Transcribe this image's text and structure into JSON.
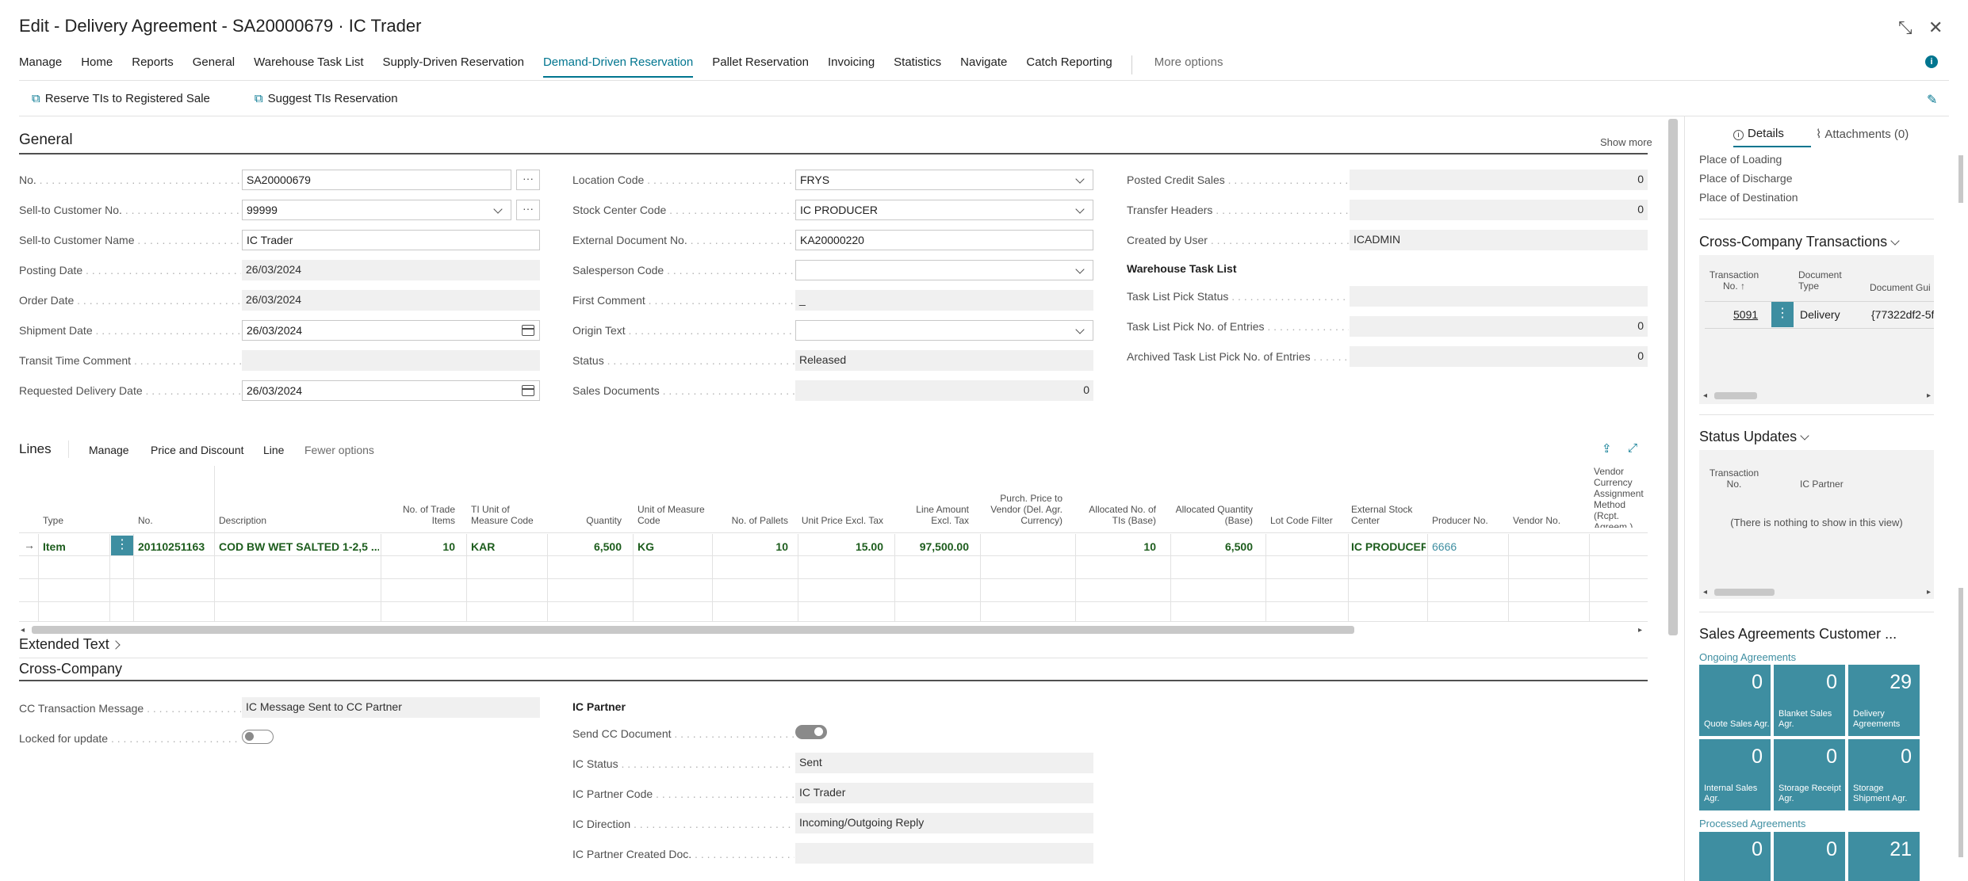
{
  "window": {
    "title": "Edit - Delivery Agreement - SA20000679 · IC Trader"
  },
  "menu": {
    "items": [
      "Manage",
      "Home",
      "Reports",
      "General",
      "Warehouse Task List",
      "Supply-Driven Reservation",
      "Demand-Driven Reservation",
      "Pallet Reservation",
      "Invoicing",
      "Statistics",
      "Navigate",
      "Catch Reporting"
    ],
    "more": "More options"
  },
  "actions": {
    "reserve": "Reserve TIs to Registered Sale",
    "suggest": "Suggest TIs Reservation"
  },
  "general": {
    "title": "General",
    "show_more": "Show more",
    "col1": [
      {
        "label": "No.",
        "value": "SA20000679"
      },
      {
        "label": "Sell-to Customer No.",
        "value": "99999"
      },
      {
        "label": "Sell-to Customer Name",
        "value": "IC Trader"
      },
      {
        "label": "Posting Date",
        "value": "26/03/2024"
      },
      {
        "label": "Order Date",
        "value": "26/03/2024"
      },
      {
        "label": "Shipment Date",
        "value": "26/03/2024"
      },
      {
        "label": "Transit Time Comment",
        "value": ""
      },
      {
        "label": "Requested Delivery Date",
        "value": "26/03/2024"
      }
    ],
    "col2": [
      {
        "label": "Location Code",
        "value": "FRYS"
      },
      {
        "label": "Stock Center Code",
        "value": "IC PRODUCER"
      },
      {
        "label": "External Document No.",
        "value": "KA20000220"
      },
      {
        "label": "Salesperson Code",
        "value": ""
      },
      {
        "label": "First Comment",
        "value": "_"
      },
      {
        "label": "Origin Text",
        "value": ""
      },
      {
        "label": "Status",
        "value": "Released"
      },
      {
        "label": "Sales Documents",
        "value": "0"
      }
    ],
    "col3": [
      {
        "label": "Posted Credit Sales",
        "value": "0"
      },
      {
        "label": "Transfer Headers",
        "value": "0"
      },
      {
        "label": "Created by User",
        "value": "ICADMIN"
      }
    ],
    "wtl_title": "Warehouse Task List",
    "col3b": [
      {
        "label": "Task List Pick Status",
        "value": ""
      },
      {
        "label": "Task List Pick No. of Entries",
        "value": "0"
      },
      {
        "label": "Archived Task List Pick No. of Entries",
        "value": "0"
      }
    ]
  },
  "lines": {
    "title": "Lines",
    "menu": [
      "Manage",
      "Price and Discount",
      "Line"
    ],
    "fewer": "Fewer options",
    "headers": [
      "Type",
      "No.",
      "Description",
      "No. of Trade Items",
      "TI Unit of Measure Code",
      "Quantity",
      "Unit of Measure Code",
      "No. of Pallets",
      "Unit Price Excl. Tax",
      "Line Amount Excl. Tax",
      "Purch. Price to Vendor (Del. Agr. Currency)",
      "Allocated No. of TIs (Base)",
      "Allocated Quantity (Base)",
      "Lot Code Filter",
      "External Stock Center",
      "Producer No.",
      "Vendor No.",
      "Vendor Currency Assignment Method (Rcpt. Agreem.)"
    ],
    "row": [
      "Item",
      "20110251163",
      "COD BW WET SALTED 1-2,5 ...",
      "10",
      "KAR",
      "6,500",
      "KG",
      "10",
      "15.00",
      "97,500.00",
      "",
      "10",
      "6,500",
      "",
      "IC PRODUCER",
      "6666",
      "",
      ""
    ]
  },
  "extended_text": {
    "title": "Extended Text"
  },
  "cross_company": {
    "title": "Cross-Company",
    "cc_msg_label": "CC Transaction Message",
    "cc_msg_value": "IC Message Sent to CC Partner",
    "locked_label": "Locked for update",
    "ic_partner_title": "IC Partner",
    "send_cc_label": "Send CC Document",
    "fields": [
      {
        "label": "IC Status",
        "value": "Sent"
      },
      {
        "label": "IC Partner Code",
        "value": "IC Trader"
      },
      {
        "label": "IC Direction",
        "value": "Incoming/Outgoing Reply"
      },
      {
        "label": "IC Partner Created Doc.",
        "value": ""
      }
    ]
  },
  "factbox": {
    "tab_details": "Details",
    "tab_attachments": "Attachments (0)",
    "places": [
      "Place of Loading",
      "Place of Discharge",
      "Place of Destination"
    ],
    "cct_title": "Cross-Company Transactions",
    "cct_headers": [
      "Transaction No. ↑",
      "Document Type",
      "Document Gui"
    ],
    "cct_row": [
      "5091",
      "Delivery",
      "{77322df2-5f"
    ],
    "su_title": "Status Updates",
    "su_headers": [
      "Transaction No.",
      "IC Partner"
    ],
    "su_empty": "(There is nothing to show in this view)",
    "sa_title": "Sales Agreements Customer ...",
    "ongoing": "Ongoing Agreements",
    "tiles1": [
      {
        "v": "0",
        "l": "Quote Sales Agr."
      },
      {
        "v": "0",
        "l": "Blanket Sales Agr."
      },
      {
        "v": "29",
        "l": "Delivery Agreements"
      }
    ],
    "tiles2": [
      {
        "v": "0",
        "l": "Internal Sales Agr."
      },
      {
        "v": "0",
        "l": "Storage Receipt Agr."
      },
      {
        "v": "0",
        "l": "Storage Shipment Agr."
      }
    ],
    "processed": "Processed Agreements",
    "tiles3": [
      {
        "v": "0"
      },
      {
        "v": "0"
      },
      {
        "v": "21"
      }
    ],
    "accent": "#3e8ea1"
  }
}
